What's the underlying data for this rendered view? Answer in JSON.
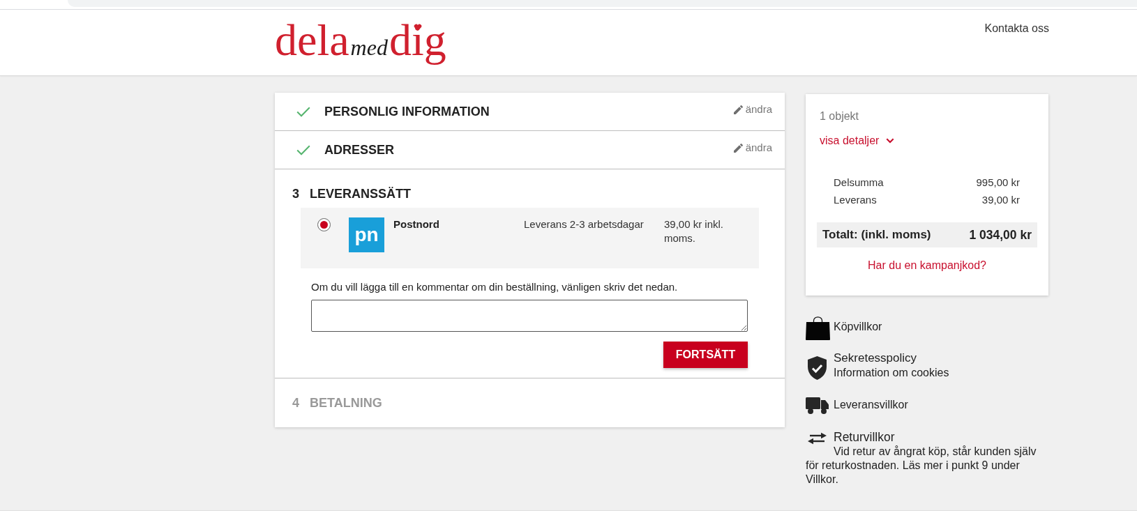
{
  "header": {
    "logo": [
      {
        "text": "dela",
        "kind": "serif"
      },
      {
        "text": "med",
        "kind": "script"
      },
      {
        "text": "dig",
        "kind": "serif"
      }
    ],
    "contact_link": "Kontakta oss"
  },
  "steps": [
    {
      "kind": "done",
      "title": "PERSONLIG INFORMATION",
      "edit_label": "ändra"
    },
    {
      "kind": "done",
      "title": "ADRESSER",
      "edit_label": "ändra"
    },
    {
      "kind": "current",
      "number": "3",
      "title": "LEVERANSSÄTT",
      "delivery": {
        "options": [
          {
            "logo_text": "pn",
            "name": "Postnord",
            "time": "Leverans 2-3 arbetsdagar",
            "price": "39,00 kr inkl. moms.",
            "selected": true
          }
        ],
        "comment_label": "Om du vill lägga till en kommentar om din beställning, vänligen skriv det nedan.",
        "continue_button": "FORTSÄTT"
      }
    },
    {
      "kind": "pending",
      "number": "4",
      "title": "BETALNING"
    }
  ],
  "summary": {
    "item_count": "1 objekt",
    "details_toggle": "visa detaljer",
    "expanded": false,
    "lines": [
      {
        "label": "Delsumma",
        "value": "995,00 kr"
      },
      {
        "label": "Leverans",
        "value": "39,00 kr"
      }
    ],
    "total": {
      "label": "Totalt: (inkl. moms)",
      "value": "1 034,00 kr"
    },
    "promo_link": "Har du en kampanjkod?"
  },
  "info_links": [
    {
      "title": "Köpvillkor"
    },
    {
      "title": "Sekretesspolicy",
      "subtitle": "Information om cookies"
    },
    {
      "title": "Leveransvillkor"
    },
    {
      "title": "Returvillkor",
      "description": "Vid retur av ångrat köp, står kunden själv för returkostnaden. Läs mer i punkt 9 under Villkor."
    }
  ]
}
